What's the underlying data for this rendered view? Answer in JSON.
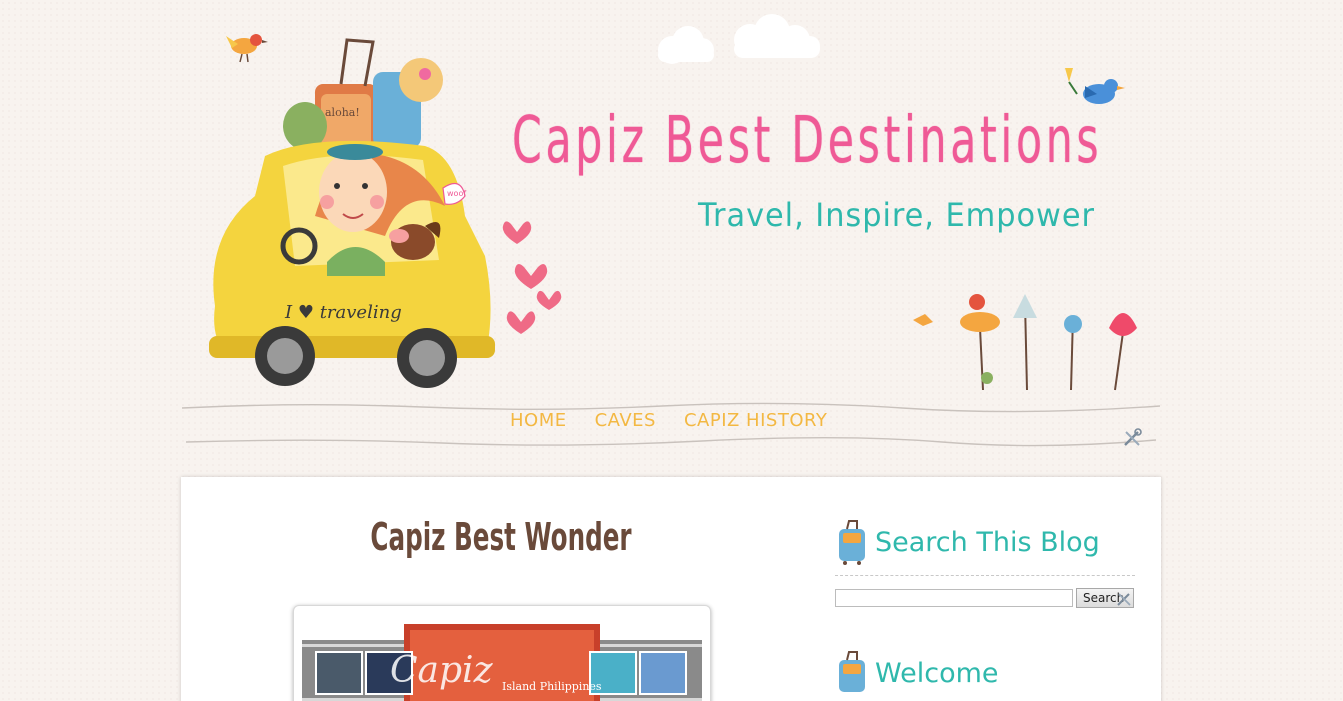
{
  "header": {
    "title": "Capiz Best Destinations",
    "tagline": "Travel, Inspire, Empower",
    "car_text": "I ♥ traveling",
    "suitcase_label": "aloha!",
    "woof": "woof"
  },
  "nav": {
    "items": [
      {
        "label": "HOME"
      },
      {
        "label": "CAVES"
      },
      {
        "label": "CAPIZ HISTORY"
      }
    ]
  },
  "post": {
    "title": "Capiz Best Wonder",
    "image_text": "Capiz",
    "image_subtext": "Island Philippines"
  },
  "sidebar": {
    "search": {
      "title": "Search This Blog",
      "input_value": "",
      "button_label": "Search"
    },
    "welcome": {
      "title": "Welcome"
    }
  },
  "colors": {
    "title_pink": "#ef5a96",
    "teal": "#2fb8ac",
    "nav_yellow": "#f3b843",
    "post_title_brown": "#6a4a3a"
  }
}
